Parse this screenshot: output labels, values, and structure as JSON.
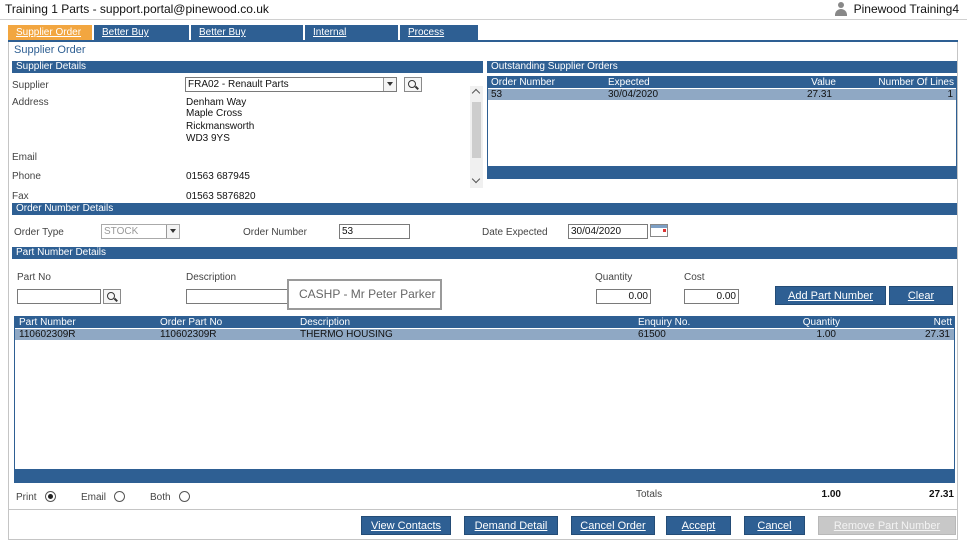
{
  "window": {
    "title": "Training 1 Parts - support.portal@pinewood.co.uk",
    "user": "Pinewood Training4"
  },
  "tabs": [
    "Supplier Order",
    "Better Buy Orders",
    "Better Buy Exceptions",
    "Internal Requests",
    "Process Order"
  ],
  "page_title": "Supplier Order",
  "supplier_details": {
    "header": "Supplier Details",
    "supplier_label": "Supplier",
    "supplier_value": "FRA02 - Renault Parts",
    "address_label": "Address",
    "address_lines": [
      "Denham Way",
      "Maple Cross",
      "Rickmansworth",
      "WD3 9YS"
    ],
    "email_label": "Email",
    "email_value": "",
    "phone_label": "Phone",
    "phone_value": "01563 687945",
    "fax_label": "Fax",
    "fax_value": "01563 5876820"
  },
  "outstanding_orders": {
    "header": "Outstanding Supplier Orders",
    "columns": [
      "Order Number",
      "Expected",
      "Value",
      "Number Of Lines"
    ],
    "rows": [
      {
        "order_number": "53",
        "expected": "30/04/2020",
        "value": "27.31",
        "lines": "1"
      }
    ]
  },
  "order_number_details": {
    "header": "Order Number Details",
    "order_type_label": "Order Type",
    "order_type_value": "STOCK",
    "order_number_label": "Order Number",
    "order_number_value": "53",
    "date_expected_label": "Date Expected",
    "date_expected_value": "30/04/2020"
  },
  "part_number_details": {
    "header": "Part Number Details",
    "part_no_label": "Part No",
    "part_no_value": "",
    "description_label": "Description",
    "description_value": "",
    "quantity_label": "Quantity",
    "quantity_value": "0.00",
    "cost_label": "Cost",
    "cost_value": "0.00",
    "add_button": "Add Part Number",
    "clear_button": "Clear",
    "tooltip": "CASHP - Mr Peter Parker"
  },
  "parts_grid": {
    "columns": [
      "Part Number",
      "Order Part No",
      "Description",
      "Enquiry No.",
      "Quantity",
      "Nett"
    ],
    "rows": [
      {
        "part_number": "110602309R",
        "order_part_no": "110602309R",
        "description": "THERMO HOUSING",
        "enquiry_no": "61500",
        "quantity": "1.00",
        "nett": "27.31"
      }
    ]
  },
  "output_options": {
    "print": "Print",
    "email": "Email",
    "both": "Both",
    "selected": "Print"
  },
  "totals": {
    "label": "Totals",
    "quantity": "1.00",
    "nett": "27.31"
  },
  "actions": {
    "view_contacts": "View Contacts",
    "demand_detail": "Demand Detail",
    "cancel_order": "Cancel Order",
    "accept": "Accept",
    "cancel": "Cancel",
    "remove_part": "Remove Part Number"
  },
  "colors": {
    "accent": "#2e5f93",
    "active_tab": "#f2a640",
    "selected_row": "#8fa8c4"
  }
}
